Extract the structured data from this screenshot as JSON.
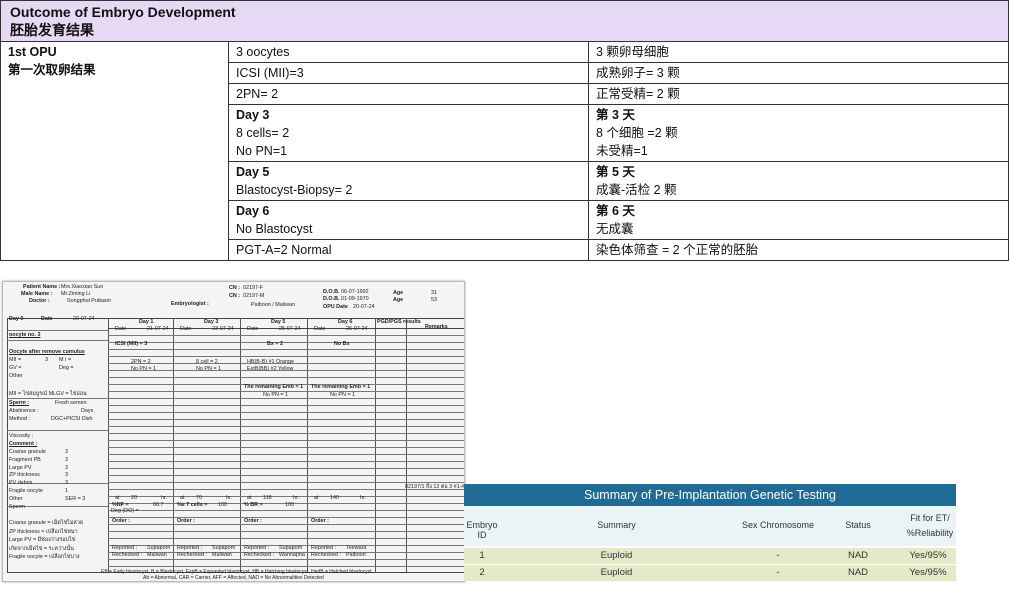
{
  "outcome": {
    "title_en": "Outcome of Embryo Development",
    "title_zh": "胚胎发育结果",
    "opu_en": "1st OPU",
    "opu_zh": "第一次取卵结果",
    "rows": [
      {
        "en": [
          "3 oocytes"
        ],
        "zh": [
          "3 颗卵母细胞"
        ]
      },
      {
        "en": [
          "ICSI (MII)=3"
        ],
        "zh": [
          "成熟卵子= 3 颗"
        ]
      },
      {
        "en": [
          "2PN= 2"
        ],
        "zh": [
          "正常受精= 2 颗"
        ]
      },
      {
        "en_head": "Day 3",
        "en": [
          "8 cells= 2",
          "No PN=1"
        ],
        "zh_head": "第 3 天",
        "zh": [
          "8 个细胞 =2 颗",
          "未受精=1"
        ]
      },
      {
        "en_head": "Day 5",
        "en": [
          "Blastocyst-Biopsy= 2"
        ],
        "zh_head": "第 5 天",
        "zh": [
          "成囊-活检 2 颗"
        ]
      },
      {
        "en_head": "Day 6",
        "en": [
          "No Blastocyst"
        ],
        "zh_head": "第 6 天",
        "zh": [
          "无成囊"
        ]
      },
      {
        "en": [
          "PGT-A=2 Normal"
        ],
        "zh": [
          "染色体筛查 = 2 个正常的胚胎"
        ]
      }
    ]
  },
  "form": {
    "patient_name_label": "Patient Name :",
    "patient_name": "Mrs.Xiaoxiao Sun",
    "male_name_label": "Male Name :",
    "male_name": "Mr.Ziming Li",
    "doctor_label": "Doctor :",
    "doctor": "Songphol Puttasiri",
    "embryologist_label": "Embryologist :",
    "embryologist": "Palboon / Maliwan",
    "cn_label": "CN :",
    "cn_f": "02197-F",
    "cn_m": "02197-M",
    "dob_label": "D.O.B.",
    "dob_f": "06-07-1992",
    "dob_m": "01-09-1970",
    "opu_label": "OPU Date",
    "opu_date": "20-07-24",
    "age_label": "Age",
    "age_f": "31",
    "age_m": "53",
    "day0": "Day 0",
    "date_label": "Date",
    "day0_date": "20-07-24",
    "oocyte_no": "oocyte no. 3",
    "after_cumulus": "Oocyte after remove cumulus",
    "mii": "MII =",
    "mii_val": "3",
    "mi": "M I =",
    "gv": "GV =",
    "deg": "Deg =",
    "other": "Other",
    "mii_mlgv": "MII = ไข่สมบูรณ์ MLGV = ไข่อ่อน",
    "sperm_label": "Sperm :",
    "sperm_val": "Fresh semen",
    "abstinence": "Abstinence :",
    "days": "Days",
    "method": "Method :",
    "method_val": "DGC+PICSI Dish",
    "viscosity": "Viscosity :",
    "comment": "Comment :",
    "comment_items": [
      {
        "k": "Coarse granule",
        "v": "3"
      },
      {
        "k": "Fragment PB",
        "v": "3"
      },
      {
        "k": "Large PV",
        "v": "3"
      },
      {
        "k": "ZP thickness",
        "v": "3"
      },
      {
        "k": "PV debris",
        "v": "3"
      },
      {
        "k": "Fragile oocyte",
        "v": "1"
      },
      {
        "k": "Other",
        "v": "SER = 3"
      }
    ],
    "sperm_row": "Sperm",
    "legend_notes": [
      "Coarse granule = เม็ดไข่ไม่สวย",
      "ZP thickness = เปลือกไข่หนา",
      "Large PV = มีช่องว่างรอบไข่",
      "เกิดจากเม็ดไข่ = ระหว่างนั้น",
      "Fragile oocyte = เปลือกไข่บาง"
    ],
    "day_cols": [
      {
        "day": "Day 1",
        "date": "21-07-24",
        "result1": "ICSI (MII) = 3",
        "result2": "2PN = 2",
        "result3": "No PN = 1",
        "at": "20",
        "stat_label": "%NF =",
        "stat_val": "66.7",
        "reported": "Supaporn",
        "rechecked": "Maliwan"
      },
      {
        "day": "Day 3",
        "date": "23-07-24",
        "result1": "",
        "result2": "8 cell = 2",
        "result3": "No PN = 1",
        "at": "70",
        "stat_label": "%≥ 7 cells =",
        "stat_val": "100",
        "reported": "Supaporn",
        "rechecked": "Maliwan"
      },
      {
        "day": "Day 5",
        "date": "25-07-24",
        "result1": "Bx = 2",
        "result2": "HB(B-B) #1 Orange",
        "result3": "ExtB(BB) #2 Yellow",
        "remain": "The remaining Emb = 1",
        "remain_sub": "No PN = 1",
        "at": "118",
        "stat_label": "% BR =",
        "stat_val": "100",
        "reported": "Supaporn",
        "rechecked": "Wannapha"
      },
      {
        "day": "Day 6",
        "date": "26-07-24",
        "result1": "No Bx",
        "result2": "",
        "result3": "",
        "remain": "The remaining Emb = 1",
        "remain_sub": "No PN = 1",
        "at": "140",
        "stat_label": "",
        "stat_val": "",
        "reported": "Teewara",
        "rechecked": "Palboon"
      }
    ],
    "pgd_label": "PGD/PGS results",
    "remarks_label": "Remarks",
    "remarks_note": "02197/1 ถึง 12 ต่อ 3 #1-#2",
    "at_label": "at",
    "hr_label": "hr.",
    "deg_do": "Deg (DO) =",
    "order_label": "Order :",
    "reported_label": "Reported :",
    "rechecked_label": "Rechecked :",
    "footer1": "EB = Early blastocyst, B = Blastocyst, ExpB = Expanded blastocyst, HB = Hatching blastocyst, HedB = Hatched blastocyst",
    "footer2": "Ab = Abnormal, CAR = Carrier, AFF = Affected, NAD = No Abnormalities Detected"
  },
  "pgt": {
    "title": "Summary of Pre-Implantation Genetic Testing",
    "headers": [
      "Embryo ID",
      "Summary",
      "Sex Chromosome",
      "Status",
      "Fit for ET/ %Reliability"
    ],
    "rows": [
      {
        "id": "1",
        "summary": "Euploid",
        "sex": "-",
        "status": "NAD",
        "fit": "Yes/95%"
      },
      {
        "id": "2",
        "summary": "Euploid",
        "sex": "-",
        "status": "NAD",
        "fit": "Yes/95%"
      }
    ]
  }
}
